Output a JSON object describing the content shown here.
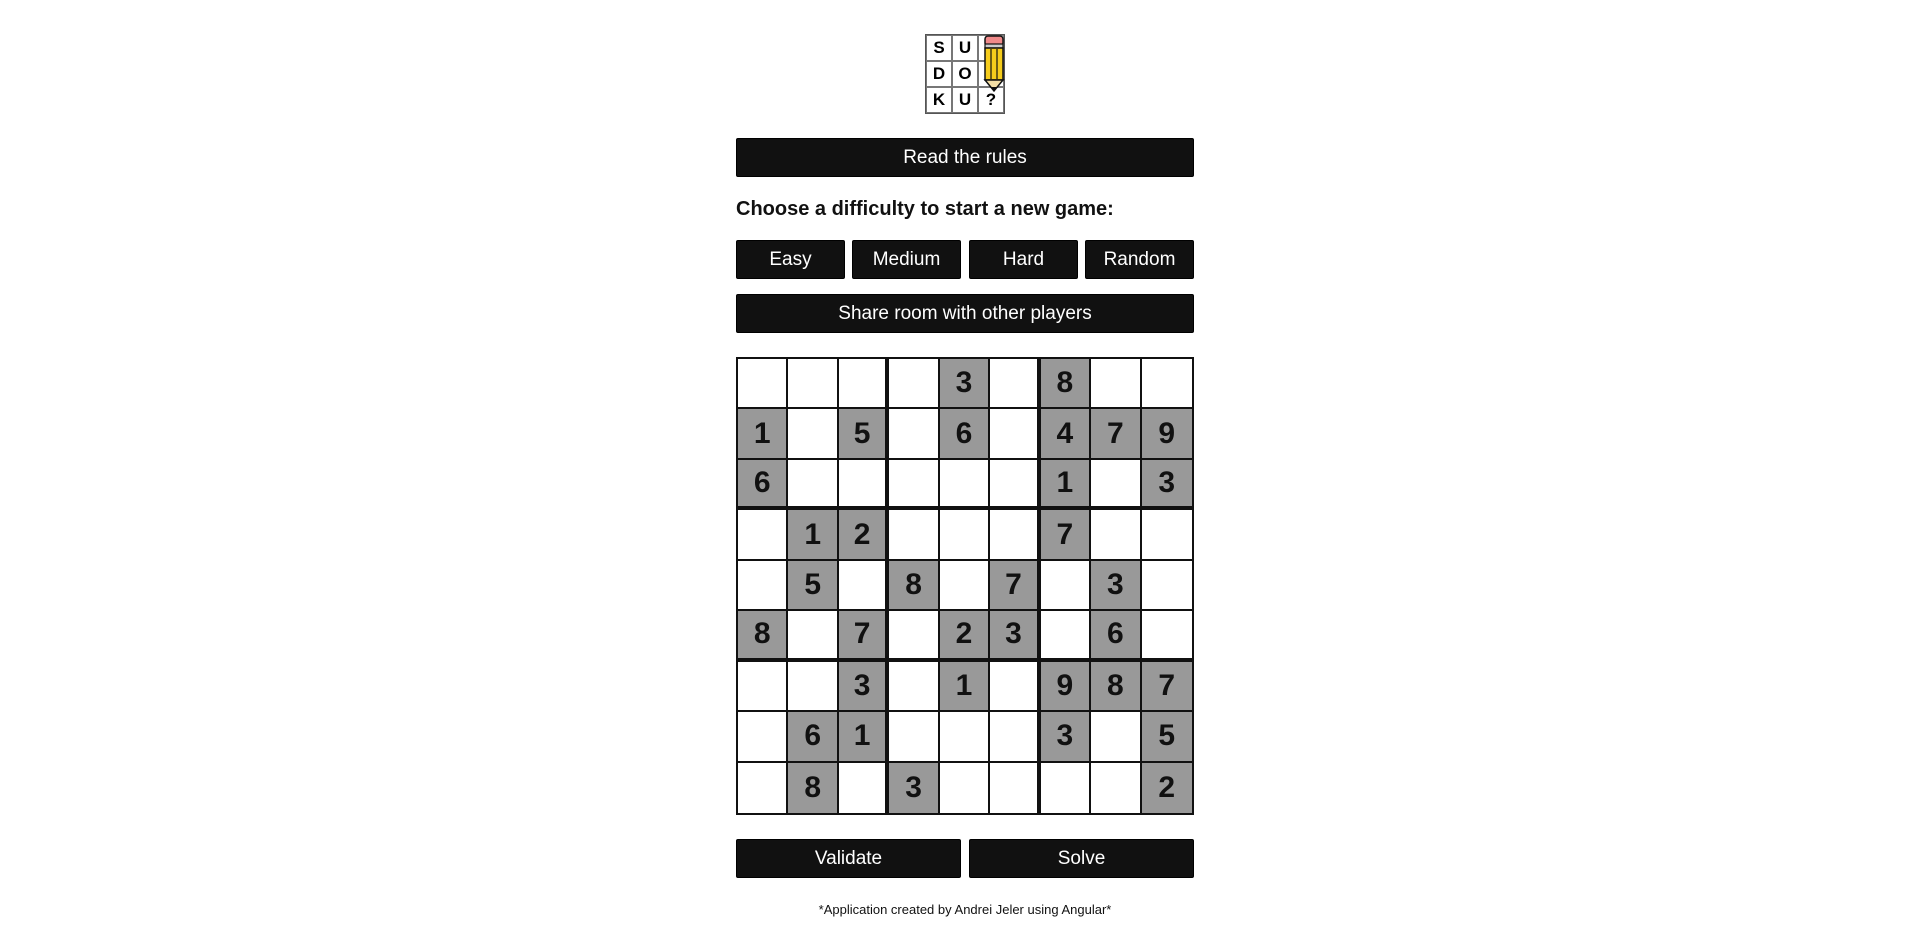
{
  "logo": {
    "letters": [
      "S",
      "U",
      "",
      "D",
      "O",
      "",
      "K",
      "U",
      "?"
    ],
    "pencil_icon": "pencil-icon",
    "colors": {
      "pencil_body": "#f5cc1c",
      "pencil_eraser": "#f08a8a"
    }
  },
  "actions": {
    "rules_label": "Read the rules",
    "difficulty_heading": "Choose a difficulty to start a new game:",
    "difficulties": [
      "Easy",
      "Medium",
      "Hard",
      "Random"
    ],
    "share_label": "Share room with other players",
    "validate_label": "Validate",
    "solve_label": "Solve"
  },
  "board": {
    "rows": [
      [
        "",
        "",
        "",
        "",
        "3",
        "",
        "8",
        "",
        ""
      ],
      [
        "1",
        "",
        "5",
        "",
        "6",
        "",
        "4",
        "7",
        "9"
      ],
      [
        "6",
        "",
        "",
        "",
        "",
        "",
        "1",
        "",
        "3"
      ],
      [
        "",
        "1",
        "2",
        "",
        "",
        "",
        "7",
        "",
        ""
      ],
      [
        "",
        "5",
        "",
        "8",
        "",
        "7",
        "",
        "3",
        ""
      ],
      [
        "8",
        "",
        "7",
        "",
        "2",
        "3",
        "",
        "6",
        ""
      ],
      [
        "",
        "",
        "3",
        "",
        "1",
        "",
        "9",
        "8",
        "7"
      ],
      [
        "",
        "6",
        "1",
        "",
        "",
        "",
        "3",
        "",
        "5"
      ],
      [
        "",
        "8",
        "",
        "3",
        "",
        "",
        "",
        "",
        "2"
      ]
    ],
    "colors": {
      "given_cell": "#999999",
      "empty_cell": "#ffffff",
      "grid_line": "#111111"
    }
  },
  "footer": {
    "credit": "*Application created by Andrei Jeler using Angular*"
  },
  "theme": {
    "button_bg": "#111111",
    "button_text": "#ffffff"
  }
}
